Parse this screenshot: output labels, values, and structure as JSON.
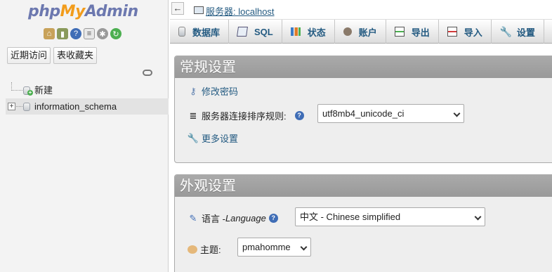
{
  "nav": {
    "logo": {
      "php": "php",
      "my": "My",
      "admin": "Admin"
    },
    "icons": [
      "home-icon",
      "logout-icon",
      "help-icon",
      "docs-icon",
      "settings-icon",
      "reload-icon"
    ],
    "tabs": {
      "recent": "近期访问",
      "favorites": "表收藏夹"
    },
    "tree": [
      {
        "label": "新建"
      },
      {
        "label": "information_schema",
        "expander": "+"
      }
    ]
  },
  "topbar": {
    "collapse": "←",
    "breadcrumb": "服务器: localhost"
  },
  "menu": [
    {
      "label": "数据库",
      "icon": "database-icon"
    },
    {
      "label": "SQL",
      "icon": "sql-icon"
    },
    {
      "label": "状态",
      "icon": "status-icon"
    },
    {
      "label": "账户",
      "icon": "accounts-icon"
    },
    {
      "label": "导出",
      "icon": "export-icon"
    },
    {
      "label": "导入",
      "icon": "import-icon"
    },
    {
      "label": "设置",
      "icon": "wrench-icon"
    }
  ],
  "general": {
    "title": "常规设置",
    "change_password": "修改密码",
    "collation_label": "服务器连接排序规则:",
    "collation_value": "utf8mb4_unicode_ci",
    "more_settings": "更多设置"
  },
  "appearance": {
    "title": "外观设置",
    "language_label_cn": "语言 - ",
    "language_label_en": "Language",
    "language_value": "中文 - Chinese simplified",
    "theme_label": "主题:",
    "theme_value": "pmahomme"
  },
  "colors": {
    "link": "#235a81",
    "legend": "#999999",
    "logo_blue": "#6c78af",
    "logo_orange": "#f29c1b"
  }
}
